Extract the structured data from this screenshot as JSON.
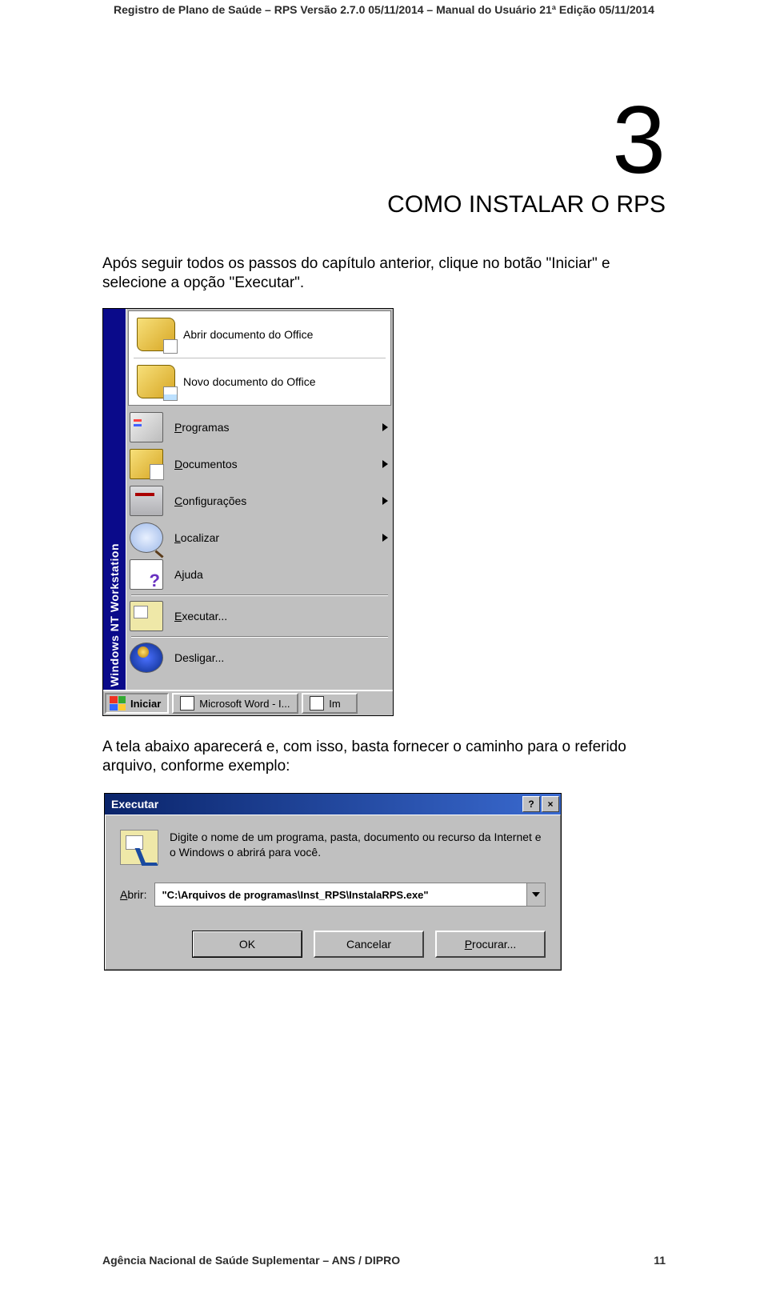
{
  "header": "Registro de Plano de Saúde – RPS Versão 2.7.0 05/11/2014 – Manual do Usuário 21ª Edição 05/11/2014",
  "chapter": {
    "number": "3",
    "title": "COMO INSTALAR O RPS"
  },
  "paragraph1": "Após seguir todos os passos do capítulo anterior, clique no botão \"Iniciar\" e selecione a opção \"Executar\".",
  "startmenu": {
    "banner": "Windows NT Workstation",
    "office_open": "Abrir documento do Office",
    "office_new": "Novo documento do Office",
    "items": {
      "programas": {
        "text": "Programas"
      },
      "documentos": {
        "text": "Documentos"
      },
      "configuracoes": {
        "text": "Configurações"
      },
      "localizar": {
        "text": "Localizar"
      },
      "ajuda": {
        "pre": "A",
        "u": "j",
        "post": "uda"
      },
      "executar": {
        "text": "Executar..."
      },
      "desligar": {
        "pre": "Desli",
        "u": "g",
        "post": "ar..."
      }
    },
    "taskbar": {
      "start": "Iniciar",
      "task1": "Microsoft Word - I...",
      "task2": "Im"
    }
  },
  "paragraph2": "A tela abaixo aparecerá e, com isso, basta fornecer o caminho para o referido arquivo, conforme exemplo:",
  "rundialog": {
    "title": "Executar",
    "help_glyph": "?",
    "close_glyph": "×",
    "message": "Digite o nome de um programa, pasta, documento ou recurso da Internet e o Windows o abrirá para você.",
    "abrir": {
      "u": "A",
      "post": "brir:"
    },
    "value": "\"C:\\Arquivos de programas\\Inst_RPS\\InstalaRPS.exe\"",
    "ok": "OK",
    "cancel": "Cancelar",
    "browse": {
      "text": "Procurar..."
    }
  },
  "footer": {
    "left": "Agência Nacional de Saúde Suplementar – ANS  /  DIPRO",
    "page": "11"
  }
}
